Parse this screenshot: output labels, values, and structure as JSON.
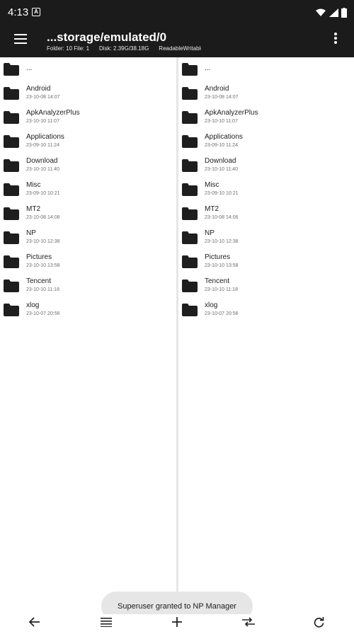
{
  "status_bar": {
    "time": "4:13",
    "notification_glyph": "A",
    "icons": [
      "wifi-icon",
      "signal-icon",
      "battery-icon"
    ]
  },
  "app_bar": {
    "title": "...storage/emulated/0",
    "folder_info": "Folder: 10  File: 1",
    "disk_info": "Disk: 2.39G/38.18G",
    "access_info": "ReadableWritable"
  },
  "left_pane": {
    "parent_label": "...",
    "items": [
      {
        "name": "Android",
        "date": "23-10-08 14:07"
      },
      {
        "name": "ApkAnalyzerPlus",
        "date": "23-10-10 11:07"
      },
      {
        "name": "Applications",
        "date": "23-09-10 11:24"
      },
      {
        "name": "Download",
        "date": "23-10-10 11:40"
      },
      {
        "name": "Misc",
        "date": "23-09-10 10:21"
      },
      {
        "name": "MT2",
        "date": "23-10-08 14:06"
      },
      {
        "name": "NP",
        "date": "23-10-10 12:38"
      },
      {
        "name": "Pictures",
        "date": "23-10-10 13:58"
      },
      {
        "name": "Tencent",
        "date": "23-10-10 11:18"
      },
      {
        "name": "xlog",
        "date": "23-10-07 20:56"
      }
    ]
  },
  "right_pane": {
    "parent_label": "...",
    "items": [
      {
        "name": "Android",
        "date": "23-10-08 14:07"
      },
      {
        "name": "ApkAnalyzerPlus",
        "date": "23-10-10 11:07"
      },
      {
        "name": "Applications",
        "date": "23-09-10 11:24"
      },
      {
        "name": "Download",
        "date": "23-10-10 11:40"
      },
      {
        "name": "Misc",
        "date": "23-09-10 10:21"
      },
      {
        "name": "MT2",
        "date": "23-10-08 14:06"
      },
      {
        "name": "NP",
        "date": "23-10-10 12:38"
      },
      {
        "name": "Pictures",
        "date": "23-10-10 13:58"
      },
      {
        "name": "Tencent",
        "date": "23-10-10 11:18"
      },
      {
        "name": "xlog",
        "date": "23-10-07 20:56"
      }
    ]
  },
  "toast": {
    "message": "Superuser granted to NP Manager"
  },
  "bottom_bar": {
    "buttons": [
      "back-arrow-icon",
      "list-menu-icon",
      "add-icon",
      "swap-icon",
      "refresh-icon"
    ]
  },
  "colors": {
    "app_bar_bg": "#1b1b1b",
    "folder_icon": "#1e1e1e",
    "toast_bg": "#e6e6e6"
  }
}
